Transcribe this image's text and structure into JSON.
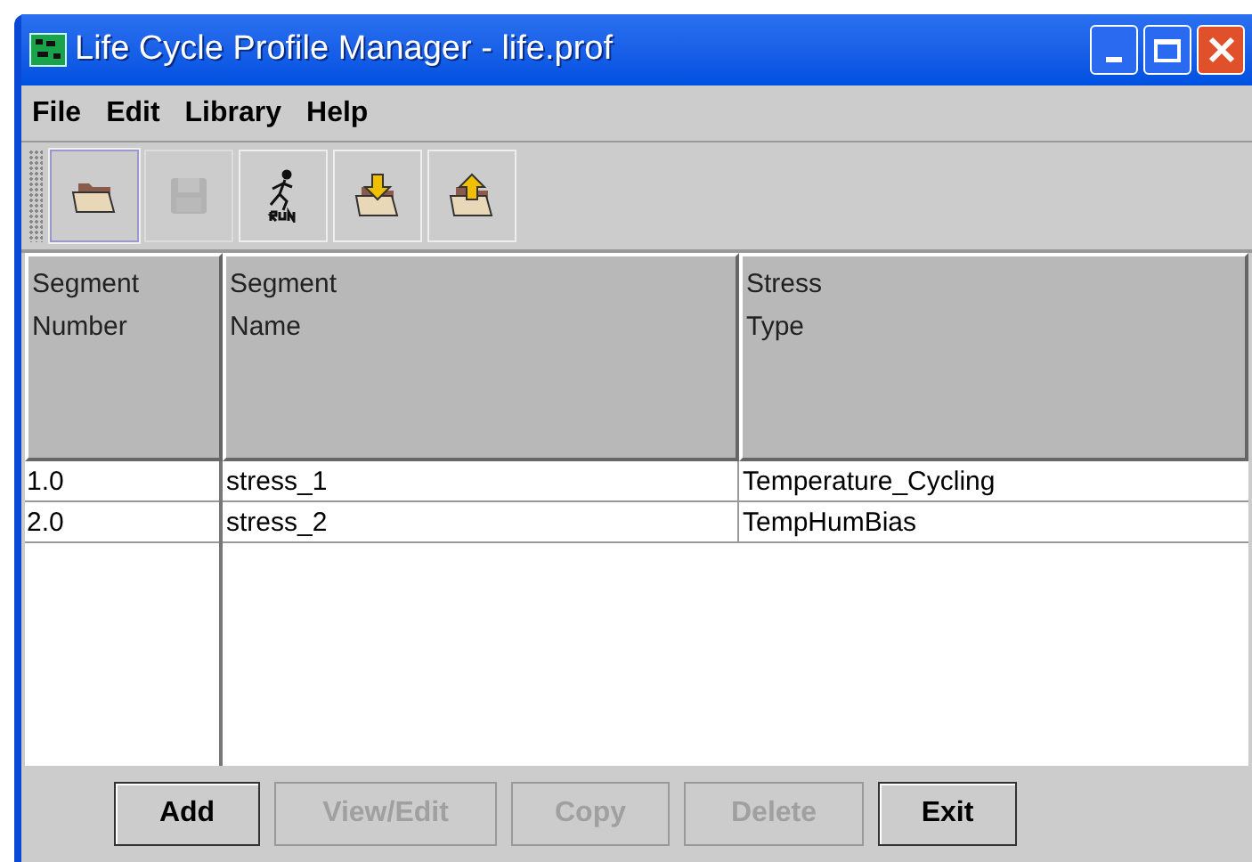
{
  "window": {
    "title": "Life Cycle Profile Manager - life.prof"
  },
  "menu": [
    "File",
    "Edit",
    "Library",
    "Help"
  ],
  "toolbar": [
    {
      "kind": "open",
      "disabled": false,
      "selected": true
    },
    {
      "kind": "save",
      "disabled": true,
      "selected": false
    },
    {
      "kind": "run",
      "disabled": false,
      "selected": false
    },
    {
      "kind": "import",
      "disabled": false,
      "selected": false
    },
    {
      "kind": "export",
      "disabled": false,
      "selected": false
    }
  ],
  "table": {
    "columns": [
      "Segment\nNumber",
      "Segment\nName",
      "Stress\nType"
    ],
    "rows": [
      [
        "1.0",
        "stress_1",
        "Temperature_Cycling"
      ],
      [
        "2.0",
        "stress_2",
        "TempHumBias"
      ]
    ]
  },
  "buttons": [
    {
      "label": "Add",
      "disabled": false
    },
    {
      "label": "View/Edit",
      "disabled": true
    },
    {
      "label": "Copy",
      "disabled": true
    },
    {
      "label": "Delete",
      "disabled": true
    },
    {
      "label": "Exit",
      "disabled": false
    }
  ]
}
